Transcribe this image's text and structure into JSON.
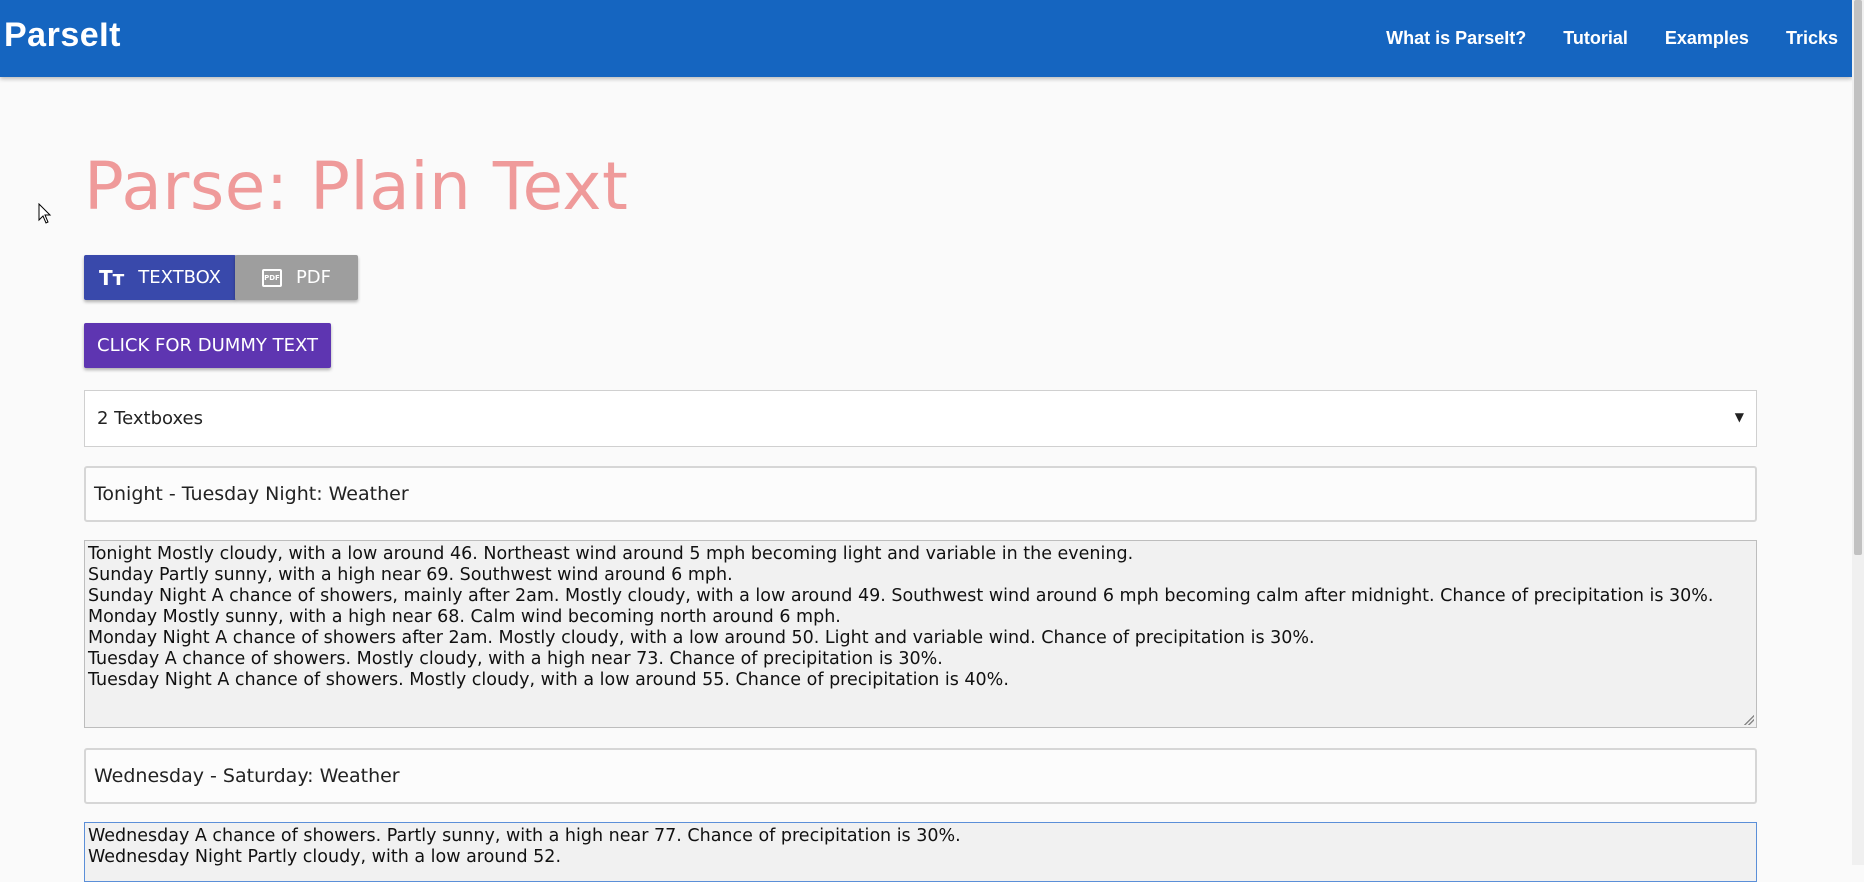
{
  "navbar": {
    "brand": "ParseIt",
    "links": [
      "What is ParseIt?",
      "Tutorial",
      "Examples",
      "Tricks"
    ]
  },
  "main": {
    "title": "Parse: Plain Text",
    "buttons": {
      "textbox": "TEXTBOX",
      "pdf": "PDF",
      "dummy": "CLICK FOR DUMMY TEXT"
    },
    "textbox_count": {
      "selected": "2 Textboxes"
    },
    "textboxes": [
      {
        "title": "Tonight - Tuesday Night: Weather",
        "lines": [
          "Tonight Mostly cloudy, with a low around 46. Northeast wind around 5 mph becoming light and variable in the evening.",
          "Sunday Partly sunny, with a high near 69. Southwest wind around 6 mph.",
          "Sunday Night A chance of showers, mainly after 2am. Mostly cloudy, with a low around 49. Southwest wind around 6 mph becoming calm after midnight. Chance of precipitation is 30%.",
          "Monday Mostly sunny, with a high near 68. Calm wind becoming north around 6 mph.",
          "Monday Night A chance of showers after 2am. Mostly cloudy, with a low around 50. Light and variable wind. Chance of precipitation is 30%.",
          "Tuesday A chance of showers. Mostly cloudy, with a high near 73. Chance of precipitation is 30%.",
          "Tuesday Night A chance of showers. Mostly cloudy, with a low around 55. Chance of precipitation is 40%."
        ]
      },
      {
        "title": "Wednesday - Saturday: Weather",
        "lines": [
          "Wednesday A chance of showers. Partly sunny, with a high near 77. Chance of precipitation is 30%.",
          "Wednesday Night Partly cloudy, with a low around 52."
        ]
      }
    ]
  },
  "colors": {
    "navbar": "#1565c0",
    "title": "#ef9a9a",
    "textbox_button": "#3949ab",
    "pdf_button": "#9e9e9e",
    "dummy_button": "#5e35b1"
  },
  "icons": {
    "textbox": "text-size-icon",
    "pdf": "pdf-file-icon",
    "select_caret": "caret-down-icon",
    "cursor": "mouse-pointer-icon"
  }
}
